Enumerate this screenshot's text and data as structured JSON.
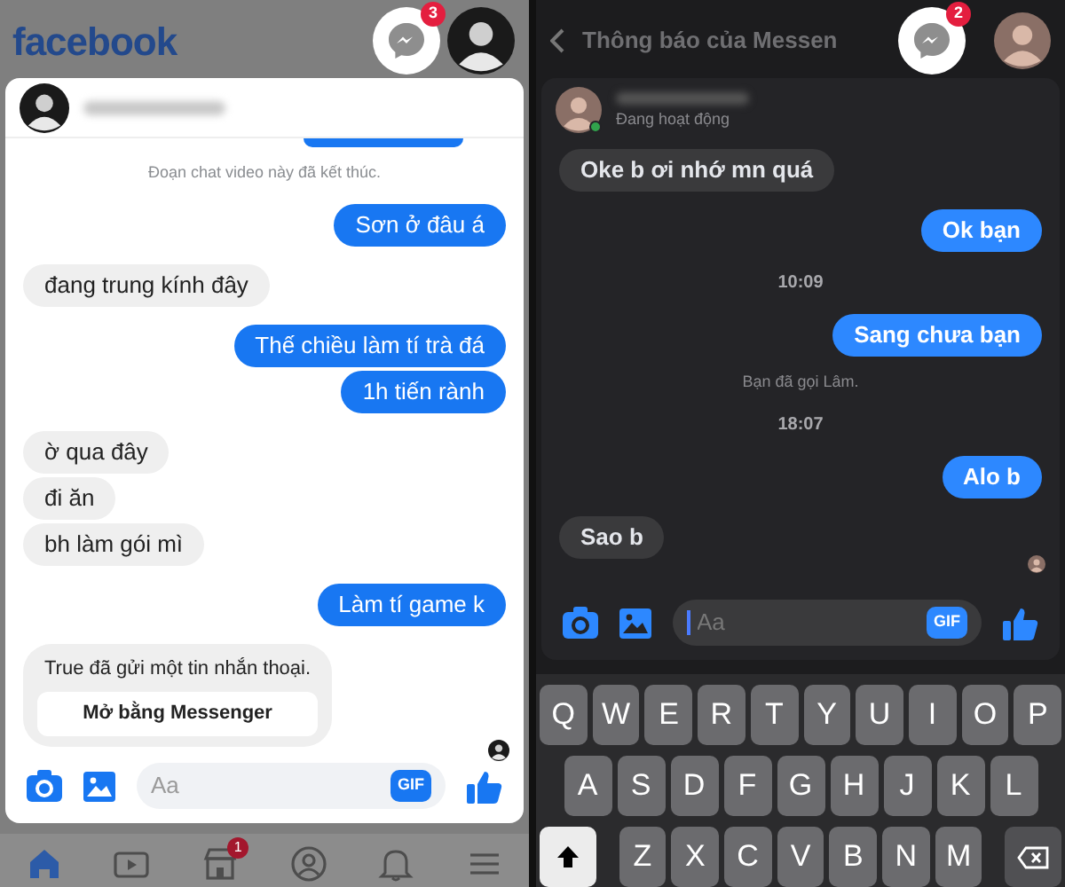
{
  "left": {
    "brand": "facebook",
    "messenger_badge": "3",
    "chat": {
      "messages": [
        {
          "kind": "sent_cut"
        },
        {
          "kind": "system",
          "text": "Đoạn chat video này đã kết thúc."
        },
        {
          "kind": "sent",
          "text": "Sơn ở đâu á"
        },
        {
          "kind": "received",
          "text": "đang trung kính đây"
        },
        {
          "kind": "sent",
          "text": "Thế chiều làm tí trà đá"
        },
        {
          "kind": "sent",
          "text": "1h tiến rành"
        },
        {
          "kind": "received",
          "text": "ờ qua đây"
        },
        {
          "kind": "received",
          "text": "đi ăn"
        },
        {
          "kind": "received",
          "text": "bh làm gói mì"
        },
        {
          "kind": "sent",
          "text": "Làm tí game k"
        },
        {
          "kind": "voice",
          "text": "True đã gửi một tin nhắn thoại.",
          "button": "Mở bằng Messenger"
        }
      ],
      "placeholder": "Aa",
      "gif": "GIF"
    },
    "nav": [
      {
        "kind": "home",
        "selected": true
      },
      {
        "kind": "video",
        "selected": false
      },
      {
        "kind": "shop",
        "selected": false,
        "badge": "1"
      },
      {
        "kind": "profile",
        "selected": false
      },
      {
        "kind": "bell",
        "selected": false
      },
      {
        "kind": "menu",
        "selected": false
      }
    ]
  },
  "right": {
    "title": "Thông báo của Messen",
    "messenger_badge": "2",
    "chat": {
      "status": "Đang hoạt động",
      "online": true,
      "messages": [
        {
          "kind": "received",
          "text": "Oke b ơi nhớ mn quá"
        },
        {
          "kind": "sent",
          "text": "Ok bạn"
        },
        {
          "kind": "time",
          "text": "10:09"
        },
        {
          "kind": "sent",
          "text": "Sang chưa bạn"
        },
        {
          "kind": "system",
          "text": "Bạn đã gọi Lâm."
        },
        {
          "kind": "time",
          "text": "18:07"
        },
        {
          "kind": "sent",
          "text": "Alo b"
        },
        {
          "kind": "received",
          "text": "Sao b"
        }
      ],
      "placeholder": "Aa",
      "gif": "GIF"
    },
    "keyboard": {
      "shift_on": true,
      "rows": [
        [
          "Q",
          "W",
          "E",
          "R",
          "T",
          "Y",
          "U",
          "I",
          "O",
          "P"
        ],
        [
          "A",
          "S",
          "D",
          "F",
          "G",
          "H",
          "J",
          "K",
          "L"
        ],
        [
          "Z",
          "X",
          "C",
          "V",
          "B",
          "N",
          "M"
        ]
      ]
    }
  }
}
